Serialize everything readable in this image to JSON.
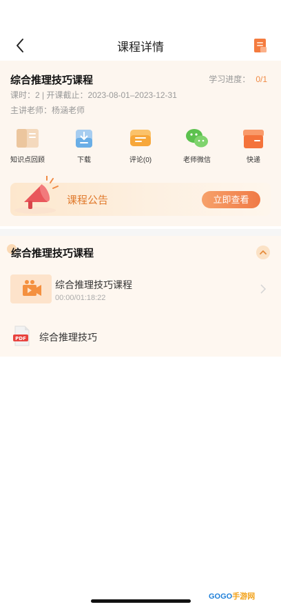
{
  "nav": {
    "title": "课程详情"
  },
  "course": {
    "title": "综合推理技巧课程",
    "progress_label": "学习进度：",
    "progress_value": "0/1",
    "meta_line": "课时：2 | 开课截止：2023-08-01–2023-12-31",
    "teacher_line": "主讲老师：杨涵老师"
  },
  "actions": [
    {
      "label": "知识点回顾",
      "icon": "book-icon"
    },
    {
      "label": "下载",
      "icon": "download-icon"
    },
    {
      "label": "评论(0)",
      "icon": "comment-icon"
    },
    {
      "label": "老师微信",
      "icon": "wechat-icon"
    },
    {
      "label": "快递",
      "icon": "box-icon"
    }
  ],
  "notice": {
    "text": "课程公告",
    "button": "立即查看"
  },
  "section": {
    "title": "综合推理技巧课程",
    "lesson": {
      "title": "综合推理技巧课程",
      "time": "00:00/01:18:22"
    },
    "file": {
      "name": "综合推理技巧",
      "badge": "PDF"
    }
  },
  "watermark": {
    "brand_a": "GOGO",
    "brand_b": "手游网"
  },
  "colors": {
    "accent": "#f07a46",
    "card_bg": "#fdf6ef",
    "progress": "#f08a44"
  }
}
